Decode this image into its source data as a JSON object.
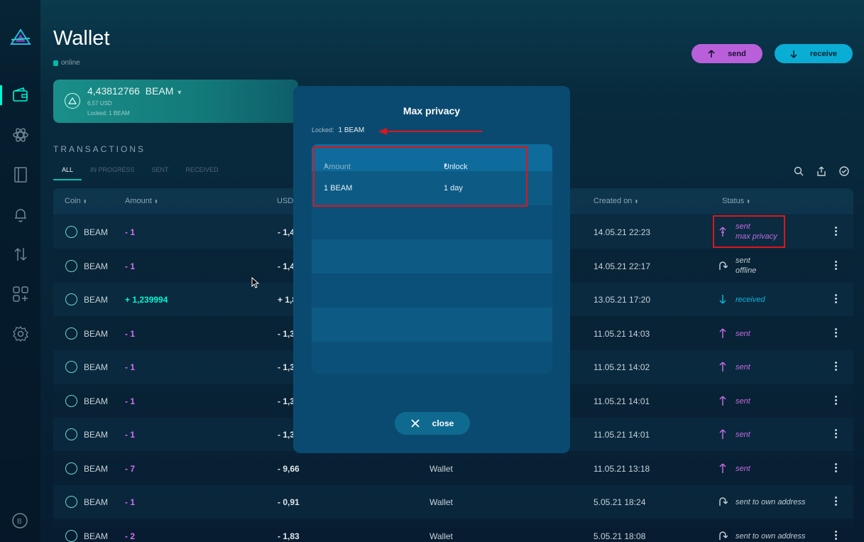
{
  "header": {
    "title": "Wallet",
    "status": "online",
    "send_label": "send",
    "receive_label": "receive"
  },
  "balance": {
    "amount": "4,43812766",
    "currency": "BEAM",
    "usd": "6,57 USD",
    "locked": "Locked: 1 BEAM"
  },
  "transactions": {
    "heading": "TRANSACTIONS",
    "tabs": [
      "ALL",
      "IN PROGRESS",
      "SENT",
      "RECEIVED"
    ],
    "columns": {
      "coin": "Coin",
      "amount": "Amount",
      "usd": "USD",
      "created": "Created on",
      "status": "Status"
    },
    "rows": [
      {
        "coin": "BEAM",
        "amount": "- 1",
        "usd": "- 1,4",
        "source": "",
        "created": "14.05.21 22:23",
        "status1": "sent",
        "status2": "max privacy",
        "kind": "sent-mp"
      },
      {
        "coin": "BEAM",
        "amount": "- 1",
        "usd": "- 1,4",
        "source": "",
        "created": "14.05.21 22:17",
        "status1": "sent",
        "status2": "offline",
        "kind": "offline"
      },
      {
        "coin": "BEAM",
        "amount": "+ 1,239994",
        "usd": "+ 1,8",
        "source": "",
        "created": "13.05.21 17:20",
        "status1": "received",
        "status2": "",
        "kind": "recv"
      },
      {
        "coin": "BEAM",
        "amount": "- 1",
        "usd": "- 1,3",
        "source": "",
        "created": "11.05.21 14:03",
        "status1": "sent",
        "status2": "",
        "kind": "sent"
      },
      {
        "coin": "BEAM",
        "amount": "- 1",
        "usd": "- 1,3",
        "source": "",
        "created": "11.05.21 14:02",
        "status1": "sent",
        "status2": "",
        "kind": "sent"
      },
      {
        "coin": "BEAM",
        "amount": "- 1",
        "usd": "- 1,3",
        "source": "",
        "created": "11.05.21 14:01",
        "status1": "sent",
        "status2": "",
        "kind": "sent"
      },
      {
        "coin": "BEAM",
        "amount": "- 1",
        "usd": "- 1,3",
        "source": "",
        "created": "11.05.21 14:01",
        "status1": "sent",
        "status2": "",
        "kind": "sent"
      },
      {
        "coin": "BEAM",
        "amount": "- 7",
        "usd": "- 9,66",
        "source": "Wallet",
        "created": "11.05.21 13:18",
        "status1": "sent",
        "status2": "",
        "kind": "sent"
      },
      {
        "coin": "BEAM",
        "amount": "- 1",
        "usd": "- 0,91",
        "source": "Wallet",
        "created": "5.05.21 18:24",
        "status1": "sent to own address",
        "status2": "",
        "kind": "own"
      },
      {
        "coin": "BEAM",
        "amount": "- 2",
        "usd": "- 1,83",
        "source": "Wallet",
        "created": "5.05.21 18:08",
        "status1": "sent to own address",
        "status2": "",
        "kind": "own"
      }
    ]
  },
  "modal": {
    "title": "Max privacy",
    "locked_label": "Locked:",
    "locked_value": "1 BEAM",
    "col_amount": "Amount",
    "col_unlock": "Unlock Time",
    "rows": [
      {
        "amount": "1 BEAM",
        "unlock": "1 day"
      }
    ],
    "close_label": "close"
  },
  "colors": {
    "accent": "#00f6d2",
    "sent": "#c36ae0",
    "received": "#0bb7d9",
    "highlight": "#e0151b"
  }
}
